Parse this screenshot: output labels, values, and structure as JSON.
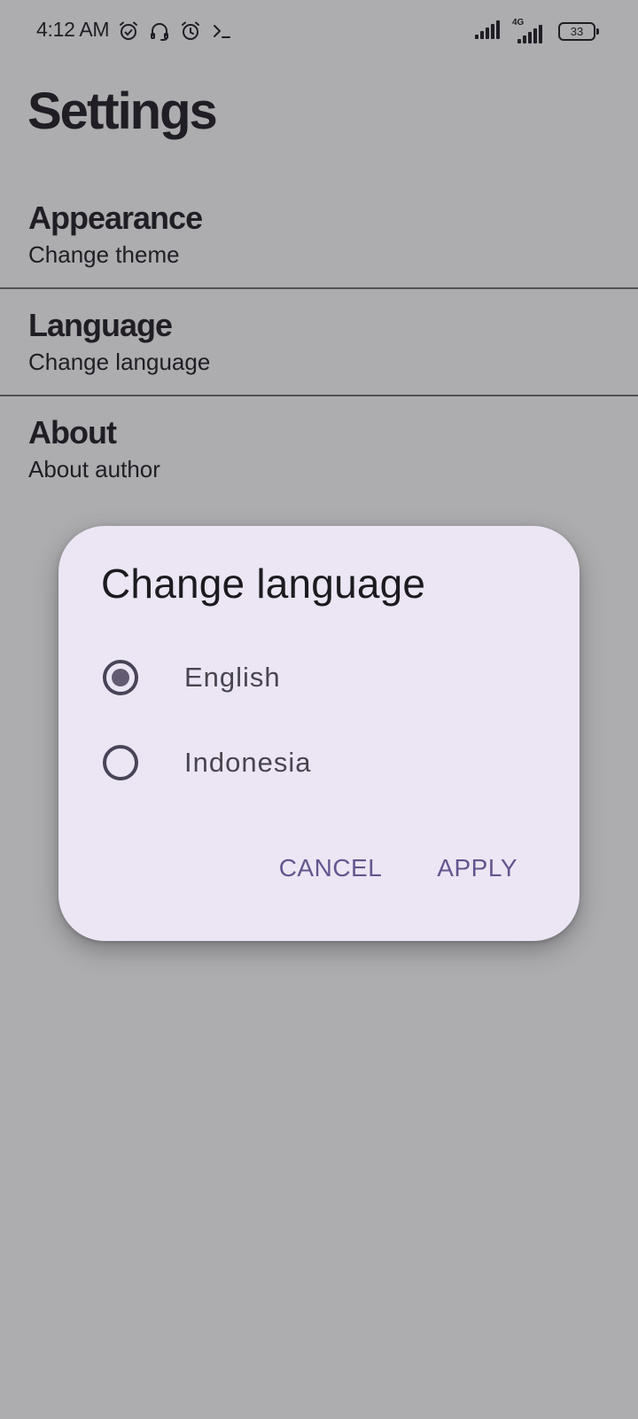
{
  "status_bar": {
    "time": "4:12 AM",
    "left_icons": [
      "alarm-icon",
      "headset-icon",
      "alarm-icon",
      "terminal-icon"
    ],
    "network_tag": "4G",
    "battery_level": "33"
  },
  "page": {
    "title": "Settings"
  },
  "settings": {
    "items": [
      {
        "title": "Appearance",
        "subtitle": "Change theme"
      },
      {
        "title": "Language",
        "subtitle": "Change language"
      },
      {
        "title": "About",
        "subtitle": "About author"
      }
    ]
  },
  "dialog": {
    "title": "Change language",
    "options": [
      {
        "label": "English",
        "selected": true
      },
      {
        "label": "Indonesia",
        "selected": false
      }
    ],
    "cancel_label": "CANCEL",
    "apply_label": "APPLY"
  },
  "colors": {
    "dialog_background": "#ece6f4",
    "accent": "#65558f",
    "radio": "#4a4458"
  }
}
